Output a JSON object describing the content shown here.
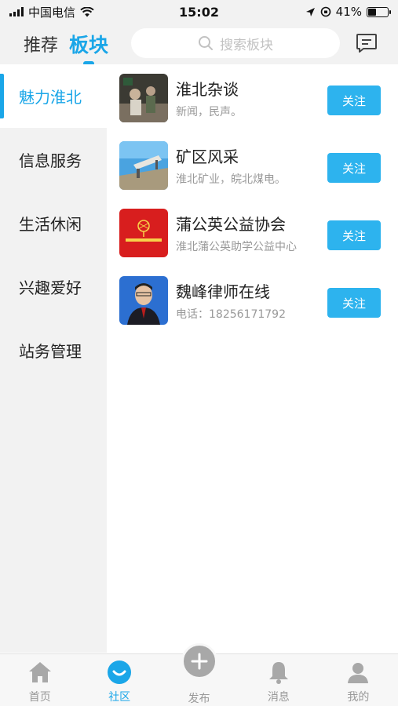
{
  "status_bar": {
    "carrier": "中国电信",
    "time": "15:02",
    "battery": "41%",
    "battery_level": 0.41
  },
  "header": {
    "tabs": [
      {
        "label": "推荐",
        "active": false
      },
      {
        "label": "板块",
        "active": true
      }
    ],
    "search_placeholder": "搜索板块",
    "accent_color": "#1aa6e8"
  },
  "sidebar": {
    "items": [
      {
        "label": "魅力淮北",
        "active": true
      },
      {
        "label": "信息服务",
        "active": false
      },
      {
        "label": "生活休闲",
        "active": false
      },
      {
        "label": "兴趣爱好",
        "active": false
      },
      {
        "label": "站务管理",
        "active": false
      }
    ]
  },
  "boards": [
    {
      "title": "淮北杂谈",
      "desc": "新闻，民声。",
      "button": "关注"
    },
    {
      "title": "矿区风采",
      "desc": "淮北矿业，皖北煤电。",
      "button": "关注"
    },
    {
      "title": "蒲公英公益协会",
      "desc": "淮北蒲公英助学公益中心",
      "button": "关注"
    },
    {
      "title": "魏峰律师在线",
      "desc": "电话：18256171792",
      "button": "关注"
    }
  ],
  "tabbar": {
    "items": [
      {
        "label": "首页",
        "icon": "home-icon",
        "active": false
      },
      {
        "label": "社区",
        "icon": "community-icon",
        "active": true
      },
      {
        "label": "发布",
        "icon": "plus-icon",
        "active": false
      },
      {
        "label": "消息",
        "icon": "bell-icon",
        "active": false
      },
      {
        "label": "我的",
        "icon": "user-icon",
        "active": false
      }
    ]
  }
}
